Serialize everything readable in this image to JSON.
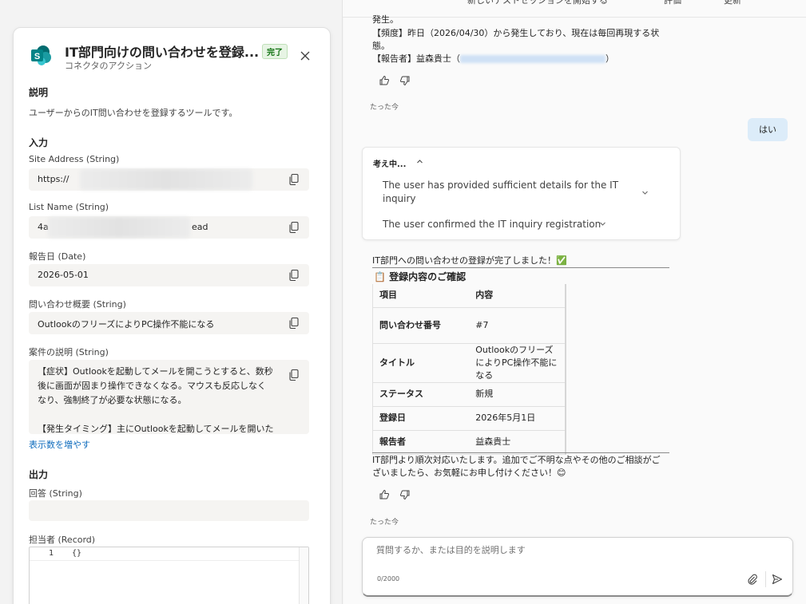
{
  "topbar": {
    "items": [
      "新しいテストセッションを開始する",
      "評価",
      "更新"
    ]
  },
  "panel": {
    "title": "IT部門向けの問い合わせを登録...",
    "badge": "完了",
    "subtitle": "コネクタのアクション",
    "description_heading": "説明",
    "description": "ユーザーからのIT問い合わせを登録するツールです。",
    "input_heading": "入力",
    "fields": [
      {
        "label": "Site Address (String)",
        "value": "https://"
      },
      {
        "label": "List Name (String)",
        "value_prefix": "4a",
        "value_suffix": "ead"
      },
      {
        "label": "報告日 (Date)",
        "value": "2026-05-01"
      },
      {
        "label": "問い合わせ概要 (String)",
        "value": "OutlookのフリーズによりPC操作不能になる"
      }
    ],
    "case_label": "案件の説明 (String)",
    "case_text": "【症状】Outlookを起動してメールを開こうとすると、数秒\n後に画面が固まり操作できなくなる。マウスも反応しなく\nなり、強制終了が必要な状態になる。\n\n【発生タイミング】主にOutlookを起動してメールを開いた\nときにフリーズ発生。",
    "show_more": "表示数を増やす",
    "output_heading": "出力",
    "answer_label": "回答 (String)",
    "owner_label": "担当者 (Record)",
    "code_line_no": "1",
    "code_text": "{}"
  },
  "chat": {
    "prev_lines": [
      "発生。",
      "【頻度】昨日（2026/04/30）から発生しており、現在は毎回再現する状",
      "態。"
    ],
    "reporter_prefix": "【報告者】益森貴士（",
    "reporter_suffix": "）",
    "timestamp": "たった今",
    "user_message": "はい",
    "thinking_label": "考え中...",
    "thinking_steps": [
      "The user has provided sufficient details for the IT inquiry",
      "The user confirmed the IT inquiry registration"
    ],
    "completion": "IT部門への問い合わせの登録が完了しました！",
    "completion_emoji": "✅",
    "table_emoji": "📋",
    "table_title": "登録内容のご確認",
    "table_headers": [
      "項目",
      "内容"
    ],
    "table_rows": [
      {
        "k": "問い合わせ番号",
        "v": "#7"
      },
      {
        "k": "タイトル",
        "v": "OutlookのフリーズによりPC操作不能になる"
      },
      {
        "k": "ステータス",
        "v": "新規"
      },
      {
        "k": "登録日",
        "v": "2026年5月1日"
      },
      {
        "k": "報告者",
        "v": "益森貴士"
      }
    ],
    "closing_line1": "IT部門より順次対応いたします。追加でご不明な点やその他のご相談がご",
    "closing_line2": "ざいましたら、お気軽にお申し付けください！",
    "closing_emoji": "😊",
    "input_placeholder": "質問するか、または目的を説明します",
    "counter": "0/2000"
  },
  "colors": {
    "accent": "#0f6cbd",
    "badge_bg": "#e7f4e4",
    "badge_text": "#0e700e",
    "user_bubble": "#dcecf9",
    "sharepoint": "#038387"
  }
}
